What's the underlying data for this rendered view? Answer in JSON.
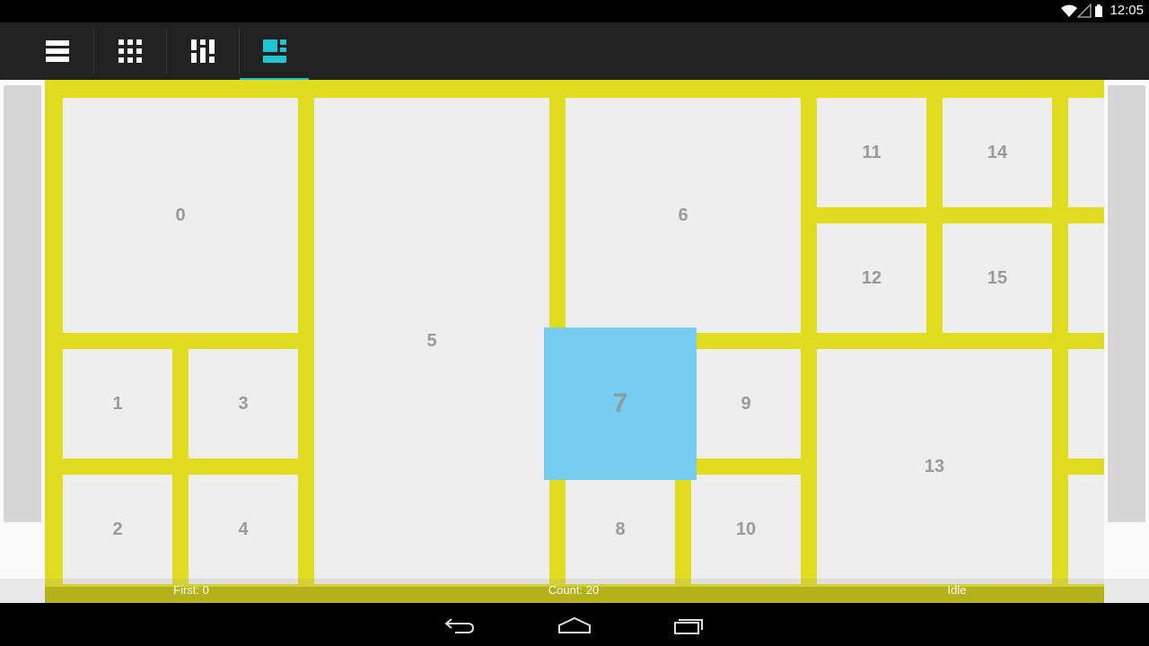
{
  "status_bar": {
    "time": "12:05",
    "icons": [
      "wifi-icon",
      "signal-icon",
      "battery-icon"
    ]
  },
  "toolbar": {
    "tabs": [
      {
        "name": "list-layout",
        "icon": "list-icon",
        "selected": false
      },
      {
        "name": "grid-layout",
        "icon": "grid-icon",
        "selected": false
      },
      {
        "name": "staggered-grid-layout",
        "icon": "staggered-grid-icon",
        "selected": false
      },
      {
        "name": "spannable-grid-layout",
        "icon": "spannable-grid-icon",
        "selected": true
      }
    ],
    "accent_color": "#1dc6cf",
    "background_color": "#212121"
  },
  "grid": {
    "background_color": "#e0dd20",
    "cell_color": "#eeeeee",
    "selected_color": "#77cdef",
    "items": [
      {
        "label": "0"
      },
      {
        "label": "1"
      },
      {
        "label": "2"
      },
      {
        "label": "3"
      },
      {
        "label": "4"
      },
      {
        "label": "5"
      },
      {
        "label": "6"
      },
      {
        "label": "7"
      },
      {
        "label": "8"
      },
      {
        "label": "9"
      },
      {
        "label": "10"
      },
      {
        "label": "11"
      },
      {
        "label": "12"
      },
      {
        "label": "13"
      },
      {
        "label": "14"
      },
      {
        "label": "15"
      }
    ],
    "selected_item": "7"
  },
  "footer": {
    "first": "First: 0",
    "count": "Count: 20",
    "state": "Idle"
  },
  "nav_bar": {
    "buttons": [
      "back-icon",
      "home-icon",
      "recents-icon"
    ]
  }
}
